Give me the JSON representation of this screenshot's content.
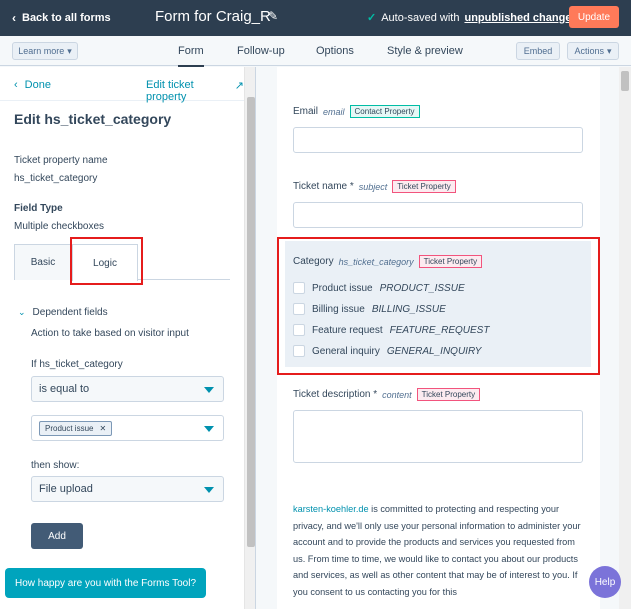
{
  "topbar": {
    "back_label": "Back to all forms",
    "form_title": "Form for Craig_R",
    "autosave_text": "Auto-saved with",
    "autosave_link": "unpublished changes",
    "update_label": "Update"
  },
  "subbar": {
    "learn_more": "Learn more",
    "tabs": [
      "Form",
      "Follow-up",
      "Options",
      "Style & preview"
    ],
    "embed": "Embed",
    "actions": "Actions"
  },
  "left": {
    "done": "Done",
    "edit_ticket_property": "Edit ticket property",
    "title": "Edit hs_ticket_category",
    "property_name_label": "Ticket property name",
    "property_name_value": "hs_ticket_category",
    "field_type_label": "Field Type",
    "field_type_value": "Multiple checkboxes",
    "tab_basic": "Basic",
    "tab_logic": "Logic",
    "dependent_fields": "Dependent fields",
    "action_text": "Action to take based on visitor input",
    "if_label": "If hs_ticket_category",
    "condition": "is equal to",
    "selected_tag": "Product issue",
    "then_show_label": "then show:",
    "then_show_value": "File upload",
    "add_button": "Add",
    "happy_prompt": "How happy are you with the Forms Tool?"
  },
  "form": {
    "email_label": "Email",
    "email_api": "email",
    "contact_badge": "Contact Property",
    "ticket_name_label": "Ticket name *",
    "ticket_name_api": "subject",
    "ticket_badge": "Ticket Property",
    "category_label": "Category",
    "category_api": "hs_ticket_category",
    "options": [
      {
        "label": "Product issue",
        "value": "PRODUCT_ISSUE"
      },
      {
        "label": "Billing issue",
        "value": "BILLING_ISSUE"
      },
      {
        "label": "Feature request",
        "value": "FEATURE_REQUEST"
      },
      {
        "label": "General inquiry",
        "value": "GENERAL_INQUIRY"
      }
    ],
    "description_label": "Ticket description *",
    "description_api": "content",
    "privacy_site": "karsten-koehler.de",
    "privacy_text": " is committed to protecting and respecting your privacy, and we'll only use your personal information to administer your account and to provide the products and services you requested from us. From time to time, we would like to contact you about our products and services, as well as other content that may be of interest to you. If you consent to us contacting you for this"
  },
  "help_label": "Help",
  "colors": {
    "topbar": "#2d3e50",
    "update": "#ff7a59",
    "link": "#0091ae",
    "highlight_box": "#e51c1c"
  }
}
